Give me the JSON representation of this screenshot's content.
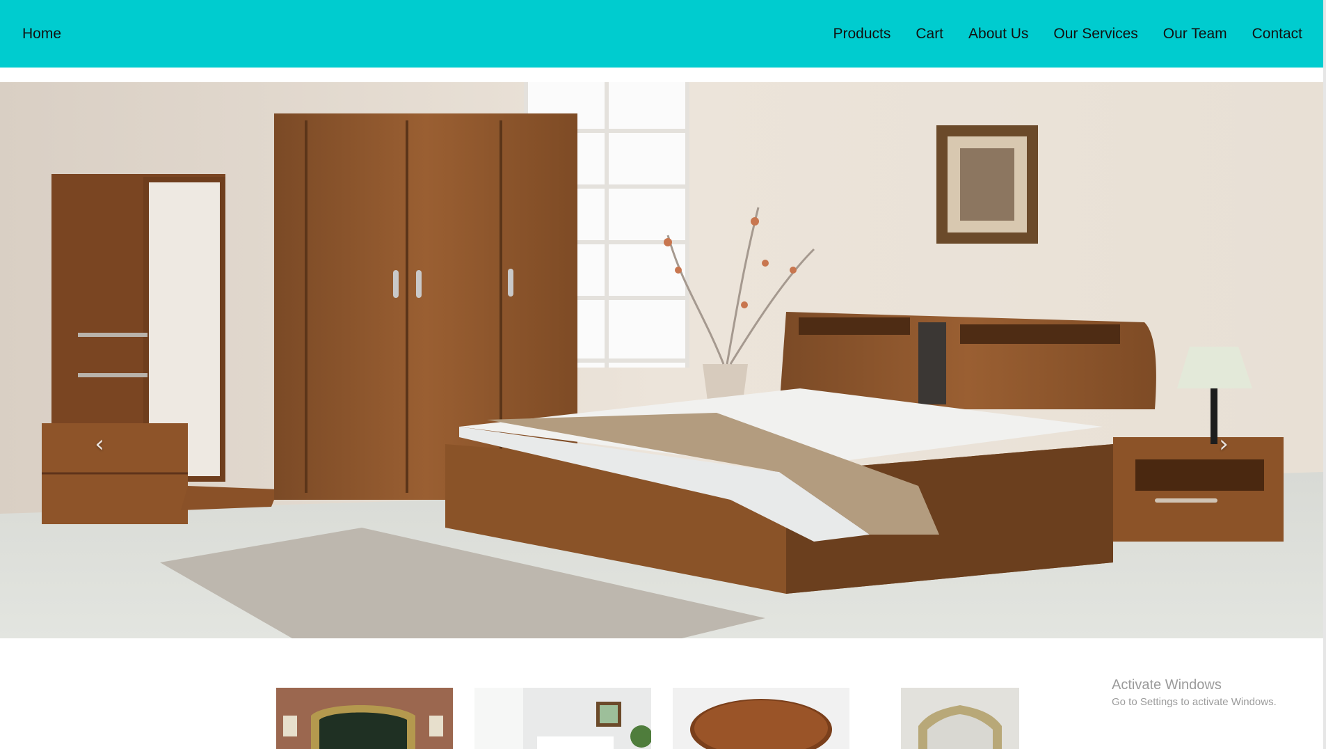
{
  "colors": {
    "navbar_bg": "#00cccf",
    "page_bg": "#ffffff"
  },
  "nav": {
    "home": "Home",
    "items": [
      {
        "label": "Products"
      },
      {
        "label": "Cart"
      },
      {
        "label": "About Us"
      },
      {
        "label": "Our Services"
      },
      {
        "label": "Our Team"
      },
      {
        "label": "Contact"
      }
    ]
  },
  "carousel": {
    "prev_icon": "chevron-left-icon",
    "next_icon": "chevron-right-icon",
    "prev_glyph": "‹",
    "next_glyph": "›",
    "slide_image": "bedroom-furniture-set"
  },
  "thumbnails": [
    {
      "image": "ornate-gold-bed"
    },
    {
      "image": "bright-living-room"
    },
    {
      "image": "round-wooden-table-top"
    },
    {
      "image": "ornate-gold-mirror"
    }
  ],
  "watermark": {
    "title": "Activate Windows",
    "subtitle": "Go to Settings to activate Windows."
  }
}
